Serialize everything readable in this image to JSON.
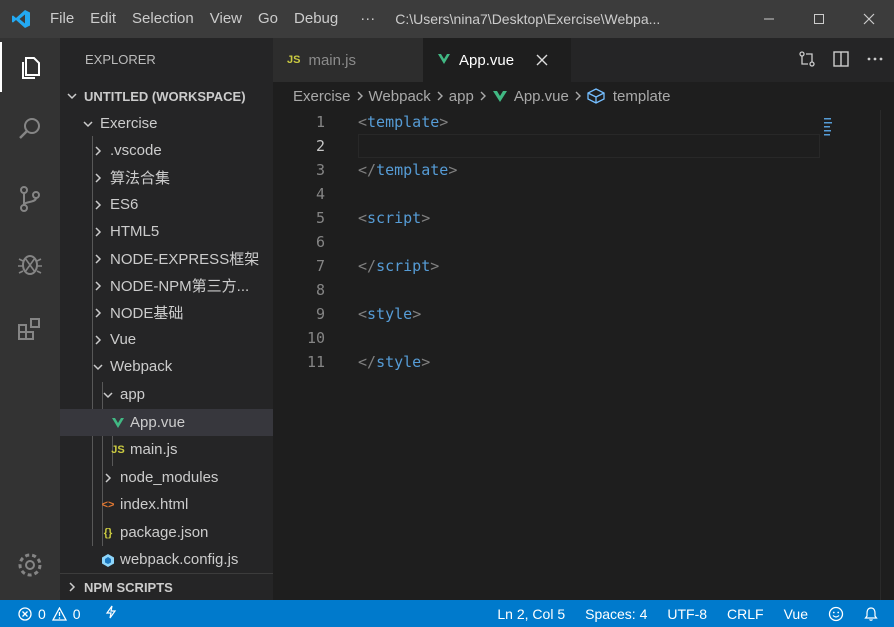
{
  "titlebar": {
    "menu": [
      "File",
      "Edit",
      "Selection",
      "View",
      "Go",
      "Debug"
    ],
    "more": "···",
    "title": "C:\\Users\\nina7\\Desktop\\Exercise\\Webpa..."
  },
  "sidebar": {
    "title": "EXPLORER",
    "workspace": "UNTITLED (WORKSPACE)",
    "npm_scripts": "NPM SCRIPTS",
    "tree": [
      {
        "label": "Exercise"
      },
      {
        "label": ".vscode"
      },
      {
        "label": "算法合集"
      },
      {
        "label": "ES6"
      },
      {
        "label": "HTML5"
      },
      {
        "label": "NODE-EXPRESS框架"
      },
      {
        "label": "NODE-NPM第三方..."
      },
      {
        "label": "NODE基础"
      },
      {
        "label": "Vue"
      },
      {
        "label": "Webpack"
      },
      {
        "label": "app"
      },
      {
        "label": "App.vue"
      },
      {
        "label": "main.js"
      },
      {
        "label": "node_modules"
      },
      {
        "label": "index.html"
      },
      {
        "label": "package.json"
      },
      {
        "label": "webpack.config.js"
      }
    ]
  },
  "icons": {
    "js_badge": "JS",
    "json_badge": "{}",
    "html_badge": "<>"
  },
  "tabs": [
    {
      "label": "main.js",
      "active": false
    },
    {
      "label": "App.vue",
      "active": true
    }
  ],
  "breadcrumb": [
    "Exercise",
    "Webpack",
    "app",
    "App.vue",
    "template"
  ],
  "editor": {
    "lines": [
      {
        "n": "1",
        "open": "<",
        "tag": "template",
        "close": ">"
      },
      {
        "n": "2",
        "open": "",
        "tag": "",
        "close": ""
      },
      {
        "n": "3",
        "open": "</",
        "tag": "template",
        "close": ">"
      },
      {
        "n": "4",
        "open": "",
        "tag": "",
        "close": ""
      },
      {
        "n": "5",
        "open": "<",
        "tag": "script",
        "close": ">"
      },
      {
        "n": "6",
        "open": "",
        "tag": "",
        "close": ""
      },
      {
        "n": "7",
        "open": "</",
        "tag": "script",
        "close": ">"
      },
      {
        "n": "8",
        "open": "",
        "tag": "",
        "close": ""
      },
      {
        "n": "9",
        "open": "<",
        "tag": "style",
        "close": ">"
      },
      {
        "n": "10",
        "open": "",
        "tag": "",
        "close": ""
      },
      {
        "n": "11",
        "open": "</",
        "tag": "style",
        "close": ">"
      }
    ]
  },
  "statusbar": {
    "errors": "0",
    "warnings": "0",
    "position": "Ln 2, Col 5",
    "spaces": "Spaces: 4",
    "encoding": "UTF-8",
    "eol": "CRLF",
    "language": "Vue"
  },
  "colors": {
    "accent": "#007acc",
    "vue_green": "#41b883",
    "js_yellow": "#cbcb41",
    "html_orange": "#e37933",
    "tag_blue": "#569cd6"
  }
}
